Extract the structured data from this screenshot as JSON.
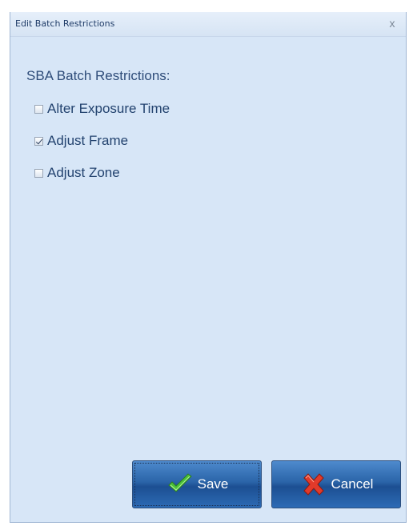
{
  "window": {
    "title": "Edit Batch Restrictions",
    "close_glyph": "x"
  },
  "section": {
    "label": "SBA Batch Restrictions:"
  },
  "options": [
    {
      "label": "Alter Exposure Time",
      "checked": false
    },
    {
      "label": "Adjust Frame",
      "checked": true
    },
    {
      "label": "Adjust Zone",
      "checked": false
    }
  ],
  "buttons": {
    "save_label": "Save",
    "save_icon": "green-checkmark-icon",
    "cancel_label": "Cancel",
    "cancel_icon": "red-x-icon"
  },
  "colors": {
    "background": "#d7e6f7",
    "button": "#2a64a8",
    "text": "#23436f"
  }
}
